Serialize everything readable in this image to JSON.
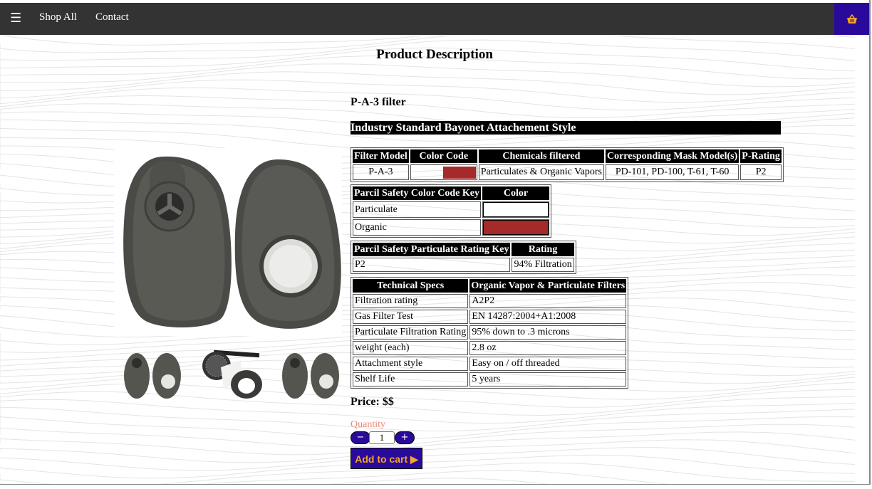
{
  "nav": {
    "menu_icon": "☰",
    "links": [
      "Shop All",
      "Contact"
    ],
    "cart_icon": "basket-icon"
  },
  "page_title": "Product Description",
  "product": {
    "name": "P-A-3 filter",
    "banner": "Industry Standard Bayonet Attachement Style",
    "price": "Price: $$"
  },
  "filter_table": {
    "headers": [
      "Filter Model",
      "Color Code",
      "Chemicals filtered",
      "Corresponding Mask Model(s)",
      "P-Rating"
    ],
    "row": {
      "model": "P-A-3",
      "color": "#a52a2a",
      "chemicals": "Particulates & Organic Vapors",
      "masks": "PD-101, PD-100, T-61, T-60",
      "rating": "P2"
    }
  },
  "color_key_table": {
    "headers": [
      "Parcil Safety Color Code Key",
      "Color"
    ],
    "rows": [
      {
        "label": "Particulate",
        "color": "#ffffff"
      },
      {
        "label": "Organic",
        "color": "#a52a2a"
      }
    ]
  },
  "particulate_table": {
    "headers": [
      "Parcil Safety Particulate Rating Key",
      "Rating"
    ],
    "rows": [
      {
        "key": "P2",
        "value": "94% Filtration"
      }
    ]
  },
  "tech_specs": {
    "headers": [
      "Technical Specs",
      "Organic Vapor & Particulate Filters"
    ],
    "rows": [
      {
        "label": "Filtration rating",
        "value": "A2P2"
      },
      {
        "label": "Gas Filter Test",
        "value": "EN 14287:2004+A1:2008"
      },
      {
        "label": "Particulate Filtration Rating",
        "value": "95% down to .3 microns"
      },
      {
        "label": "weight (each)",
        "value": "2.8 oz"
      },
      {
        "label": "Attachment style",
        "value": "Easy on / off threaded"
      },
      {
        "label": "Shelf Life",
        "value": "5 years"
      }
    ]
  },
  "cart": {
    "quantity_label": "Quantity",
    "quantity": "1",
    "minus": "−",
    "plus": "+",
    "add_label": "Add to cart ▶"
  },
  "colors": {
    "topbar": "#333333",
    "accent": "#2a0a9a",
    "button_text": "#f5a623",
    "quantity_label": "#e98b7a",
    "organic": "#a52a2a"
  }
}
